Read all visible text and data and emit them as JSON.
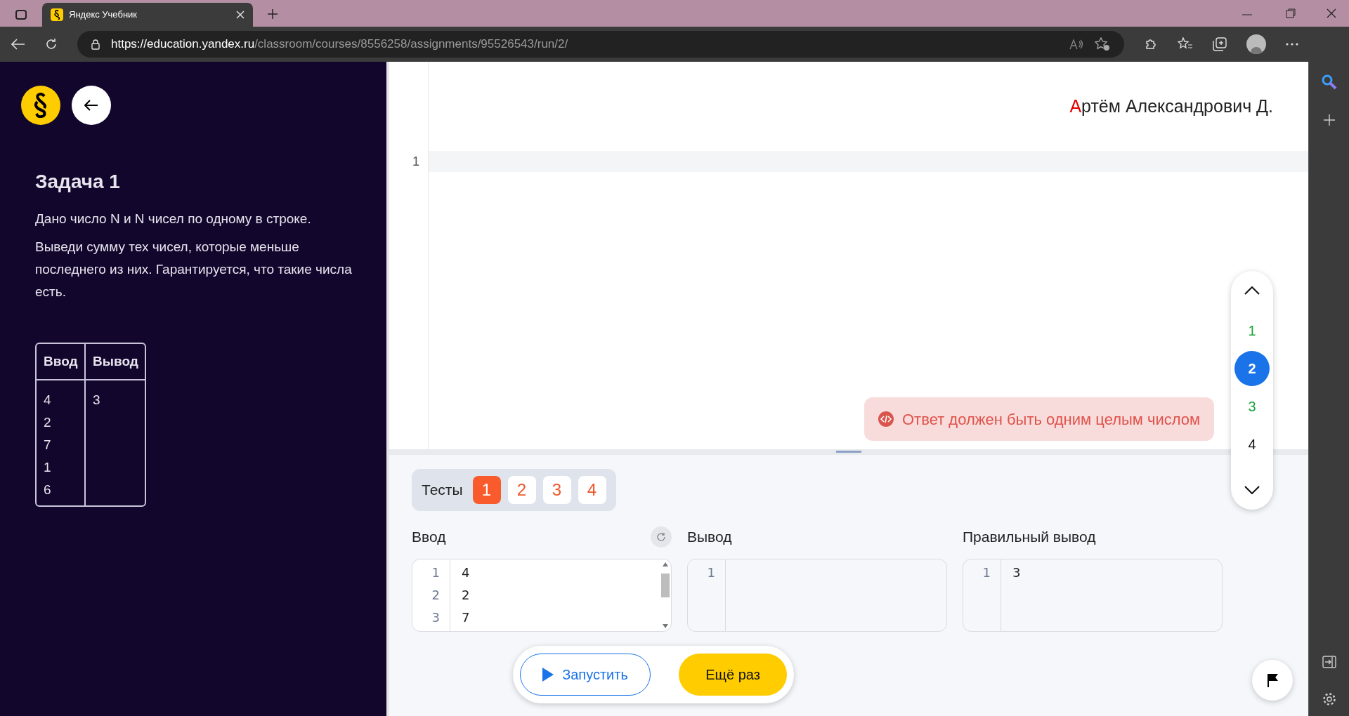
{
  "browser": {
    "tab_title": "Яндекс Учебник",
    "url_host": "https://education.yandex.ru",
    "url_path": "/classroom/courses/8556258/assignments/95526543/run/2/"
  },
  "task": {
    "title": "Задача 1",
    "paragraphs": [
      "Дано число N и N чисел по одному в строке.",
      "Выведи сумму тех чисел, которые меньше последнего из них. Гарантируется, что такие числа есть."
    ],
    "example": {
      "columns": [
        "Ввод",
        "Вывод"
      ],
      "input_lines": [
        "4",
        "2",
        "7",
        "1",
        "6"
      ],
      "output_lines": [
        "3"
      ]
    }
  },
  "editor": {
    "author": "Артём Александрович Д.",
    "line_numbers": [
      "1"
    ],
    "error": "Ответ должен быть одним целым числом"
  },
  "test_nav": [
    {
      "label": "1",
      "passed": true,
      "selected": false
    },
    {
      "label": "2",
      "passed": false,
      "selected": true
    },
    {
      "label": "3",
      "passed": true,
      "selected": false
    },
    {
      "label": "4",
      "passed": false,
      "selected": false
    }
  ],
  "tests": {
    "label": "Тесты",
    "items": [
      {
        "label": "1",
        "selected": true
      },
      {
        "label": "2",
        "selected": false
      },
      {
        "label": "3",
        "selected": false
      },
      {
        "label": "4",
        "selected": false
      }
    ]
  },
  "panes": [
    {
      "title": "Ввод",
      "lines": [
        {
          "n": "1",
          "text": "4"
        },
        {
          "n": "2",
          "text": "2"
        },
        {
          "n": "3",
          "text": "7"
        }
      ],
      "kind": "input"
    },
    {
      "title": "Вывод",
      "lines": [
        {
          "n": "1"
        }
      ],
      "kind": "output"
    },
    {
      "title": "Правильный вывод",
      "lines": [
        {
          "n": "1",
          "text": "3"
        }
      ],
      "kind": "expected"
    }
  ],
  "buttons": {
    "run": "Запустить",
    "retry": "Ещё раз"
  }
}
